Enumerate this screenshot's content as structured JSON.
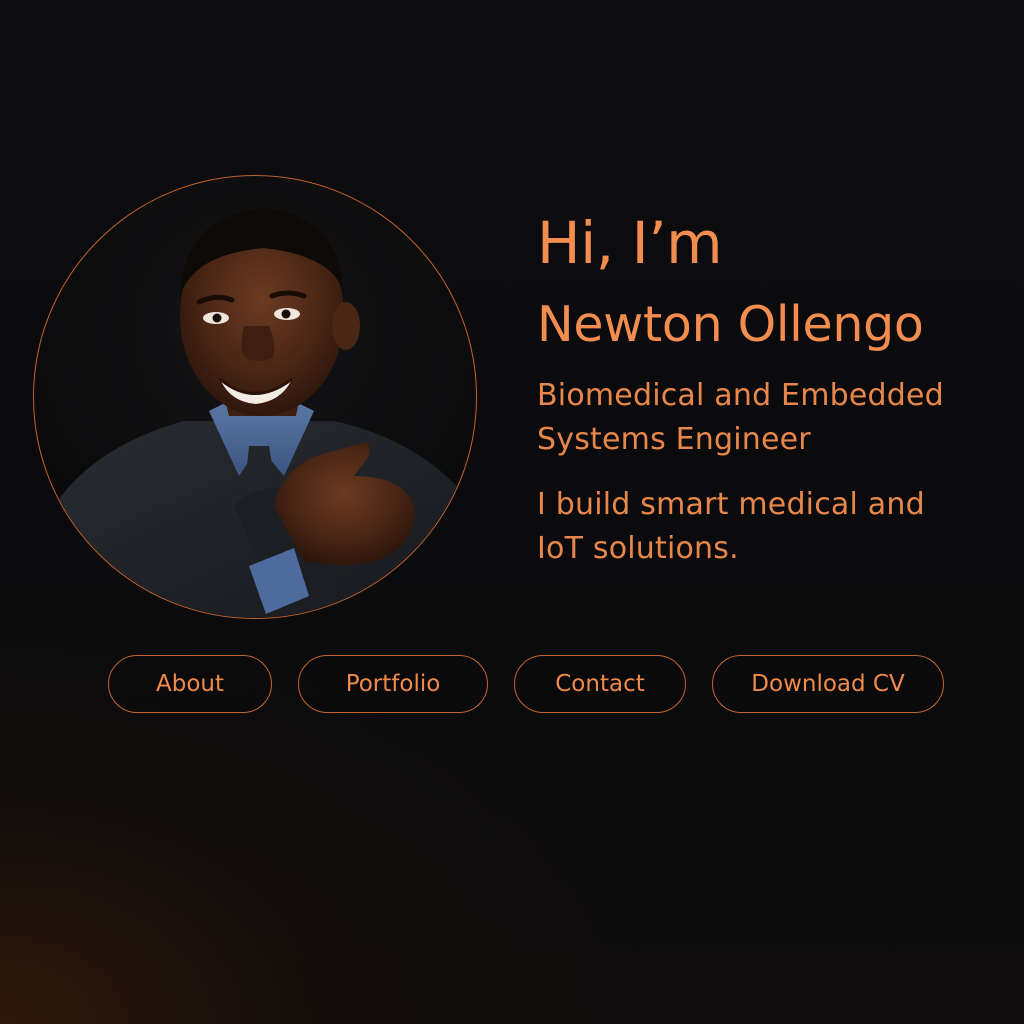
{
  "hero": {
    "greeting": "Hi, I’m",
    "name": "Newton Ollengo",
    "role_line1": "Biomedical and Embedded",
    "role_line2": "Systems Engineer",
    "tagline_line1": "I build smart medical and",
    "tagline_line2": "IoT solutions."
  },
  "nav": {
    "about": "About",
    "portfolio": "Portfolio",
    "contact": "Contact",
    "download_cv": "Download CV"
  },
  "colors": {
    "accent": "#f28c4f",
    "border": "#c2642e",
    "background": "#0b0b0d"
  }
}
